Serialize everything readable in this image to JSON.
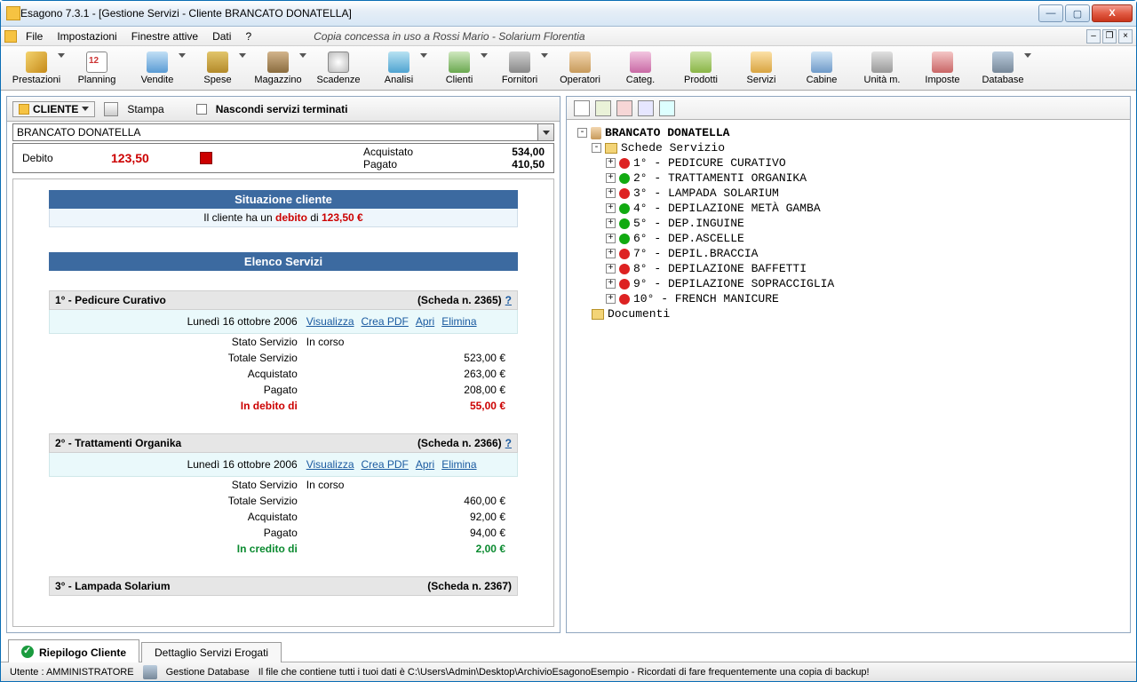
{
  "window": {
    "title": "Esagono 7.3.1 - [Gestione Servizi - Cliente BRANCATO DONATELLA]"
  },
  "menubar": {
    "items": [
      "File",
      "Impostazioni",
      "Finestre attive",
      "Dati",
      "?"
    ],
    "center_info": "Copia concessa in uso a Rossi Mario - Solarium Florentia"
  },
  "toolbar": {
    "items": [
      {
        "label": "Prestazioni",
        "dd": true
      },
      {
        "label": "Planning",
        "dd": false
      },
      {
        "label": "Vendite",
        "dd": true
      },
      {
        "label": "Spese",
        "dd": true
      },
      {
        "label": "Magazzino",
        "dd": true
      },
      {
        "label": "Scadenze",
        "dd": false
      },
      {
        "label": "Analisi",
        "dd": true
      },
      {
        "label": "Clienti",
        "dd": true
      },
      {
        "label": "Fornitori",
        "dd": true
      },
      {
        "label": "Operatori",
        "dd": false
      },
      {
        "label": "Categ.",
        "dd": false
      },
      {
        "label": "Prodotti",
        "dd": false
      },
      {
        "label": "Servizi",
        "dd": false
      },
      {
        "label": "Cabine",
        "dd": false
      },
      {
        "label": "Unità m.",
        "dd": false
      },
      {
        "label": "Imposte",
        "dd": false
      },
      {
        "label": "Database",
        "dd": true
      }
    ]
  },
  "left": {
    "cliente_btn": "CLIENTE",
    "stampa": "Stampa",
    "nascondi_check_label": "Nascondi servizi terminati",
    "client_name": "BRANCATO DONATELLA",
    "debit_label": "Debito",
    "debit_amount": "123,50",
    "acquistato_label": "Acquistato",
    "pagato_label": "Pagato",
    "acquistato_val": "534,00",
    "pagato_val": "410,50",
    "situ_header": "Situazione cliente",
    "situ_text_pre": "Il cliente ha un ",
    "situ_debt_word": "debito",
    "situ_text_mid": " di ",
    "situ_debt_amt": "123,50 €",
    "elenco_header": "Elenco Servizi",
    "services": [
      {
        "title": "1° - Pedicure Curativo",
        "scheda": "(Scheda n. 2365)",
        "date": "Lunedì 16 ottobre 2006",
        "links": [
          "Visualizza",
          "Crea PDF",
          "Apri",
          "Elimina"
        ],
        "rows": [
          {
            "l": "Stato Servizio",
            "r": "In corso",
            "cls": ""
          },
          {
            "l": "Totale Servizio",
            "r": "523,00 €",
            "cls": "euro"
          },
          {
            "l": "Acquistato",
            "r": "263,00 €",
            "cls": "euro"
          },
          {
            "l": "Pagato",
            "r": "208,00 €",
            "cls": "euro"
          },
          {
            "l": "In debito di",
            "r": "55,00 €",
            "cls": "euro red bold"
          }
        ]
      },
      {
        "title": "2° - Trattamenti Organika",
        "scheda": "(Scheda n. 2366)",
        "date": "Lunedì 16 ottobre 2006",
        "links": [
          "Visualizza",
          "Crea PDF",
          "Apri",
          "Elimina"
        ],
        "rows": [
          {
            "l": "Stato Servizio",
            "r": "In corso",
            "cls": ""
          },
          {
            "l": "Totale Servizio",
            "r": "460,00 €",
            "cls": "euro"
          },
          {
            "l": "Acquistato",
            "r": "92,00 €",
            "cls": "euro"
          },
          {
            "l": "Pagato",
            "r": "94,00 €",
            "cls": "euro"
          },
          {
            "l": "In credito di",
            "r": "2,00 €",
            "cls": "euro green bold"
          }
        ]
      },
      {
        "title": "3° - Lampada Solarium",
        "scheda": "(Scheda n. 2367)",
        "date": "",
        "links": [],
        "rows": []
      }
    ]
  },
  "right": {
    "root": "BRANCATO DONATELLA",
    "schede_label": "Schede Servizio",
    "items": [
      {
        "n": "1°",
        "color": "red",
        "name": "PEDICURE CURATIVO"
      },
      {
        "n": "2°",
        "color": "green",
        "name": "TRATTAMENTI ORGANIKA"
      },
      {
        "n": "3°",
        "color": "red",
        "name": "LAMPADA SOLARIUM"
      },
      {
        "n": "4°",
        "color": "green",
        "name": "DEPILAZIONE METÀ GAMBA"
      },
      {
        "n": "5°",
        "color": "green",
        "name": "DEP.INGUINE"
      },
      {
        "n": "6°",
        "color": "green",
        "name": "DEP.ASCELLE"
      },
      {
        "n": "7°",
        "color": "red",
        "name": "DEPIL.BRACCIA"
      },
      {
        "n": "8°",
        "color": "red",
        "name": "DEPILAZIONE BAFFETTI"
      },
      {
        "n": "9°",
        "color": "red",
        "name": "DEPILAZIONE SOPRACCIGLIA"
      },
      {
        "n": "10°",
        "color": "red",
        "name": "FRENCH MANICURE"
      }
    ],
    "documenti": "Documenti"
  },
  "tabs": {
    "active": "Riepilogo Cliente",
    "other": "Dettaglio Servizi Erogati"
  },
  "status": {
    "user": "Utente : AMMINISTRATORE",
    "dblabel": "Gestione Database",
    "msg": "Il file che contiene tutti i tuoi dati è C:\\Users\\Admin\\Desktop\\ArchivioEsagonoEsempio - Ricordati di fare frequentemente una copia di backup!"
  }
}
